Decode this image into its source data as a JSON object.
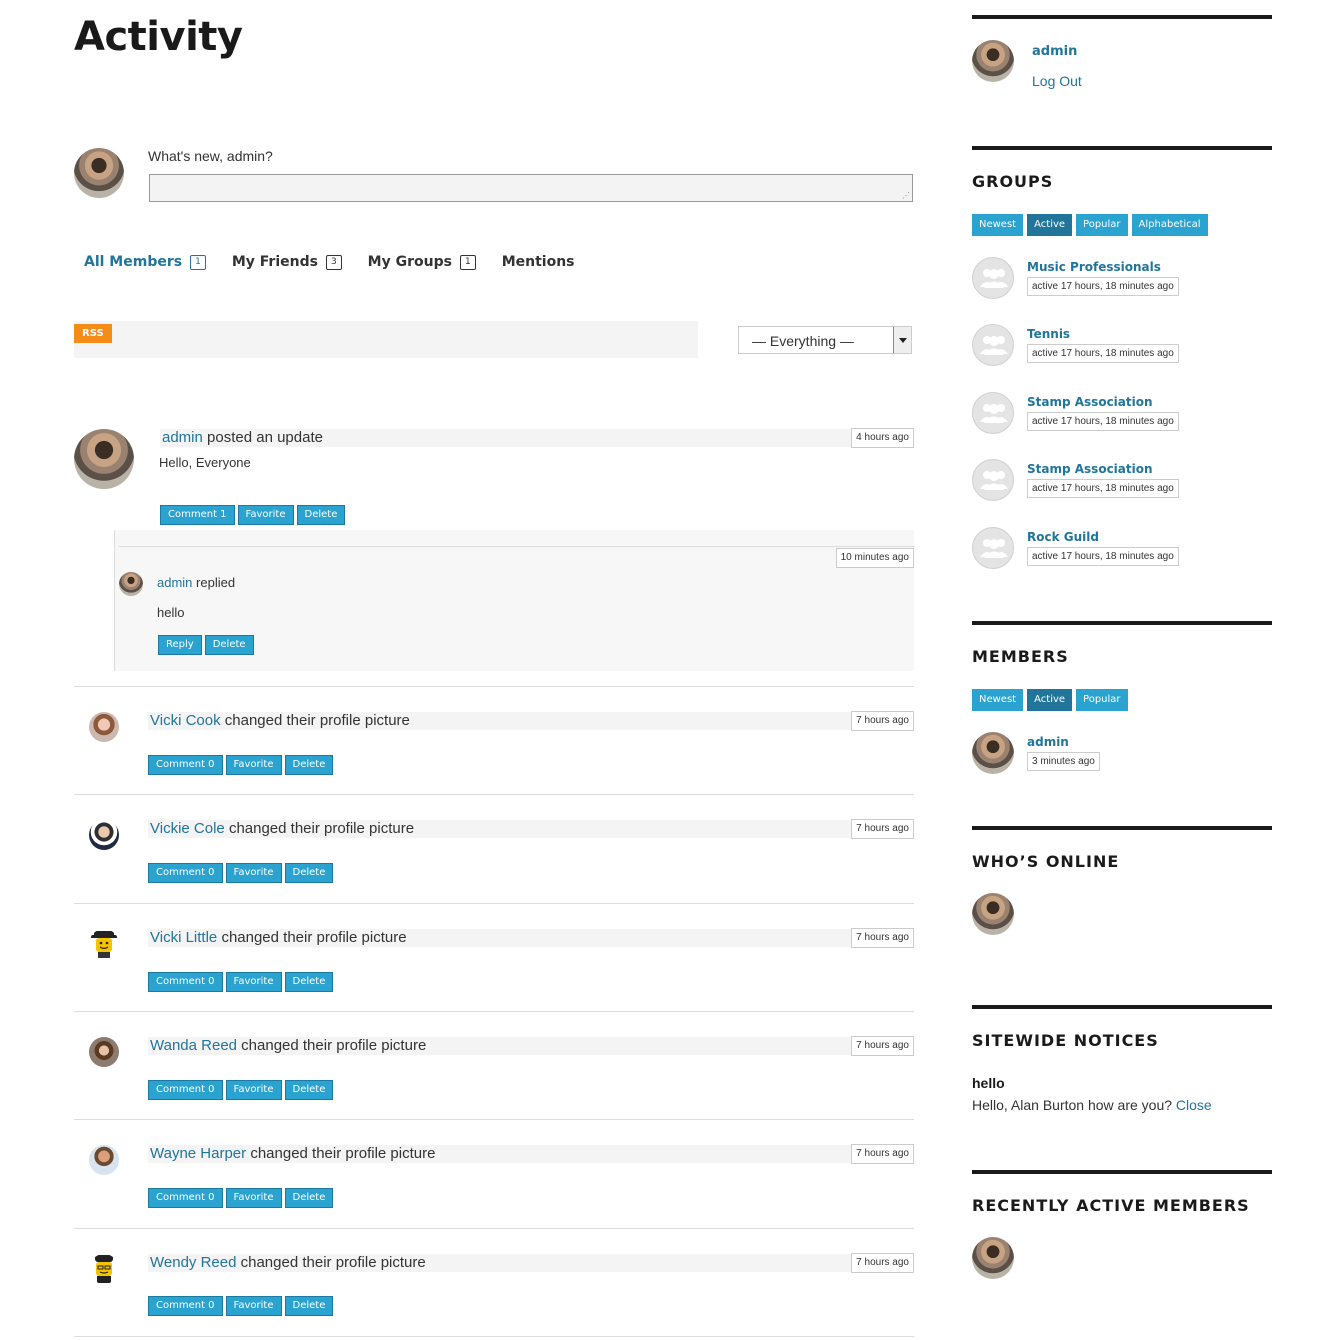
{
  "page": {
    "title": "Activity"
  },
  "post_form": {
    "greeting": "What's new, admin?",
    "placeholder": ""
  },
  "tabs": [
    {
      "label": "All Members",
      "count": "1"
    },
    {
      "label": "My Friends",
      "count": "3"
    },
    {
      "label": "My Groups",
      "count": "1"
    },
    {
      "label": "Mentions",
      "count": ""
    }
  ],
  "filter": {
    "rss_label": "RSS",
    "selected": "— Everything —"
  },
  "main_post": {
    "user": "admin",
    "action": "posted an update",
    "time": "4 hours ago",
    "content": "Hello, Everyone",
    "buttons": [
      "Comment 1",
      "Favorite",
      "Delete"
    ],
    "comment": {
      "time": "10 minutes ago",
      "user": "admin",
      "action": "replied",
      "content": "hello",
      "buttons": [
        "Reply",
        "Delete"
      ]
    }
  },
  "activities": [
    {
      "user": "Vicki Cook",
      "action": "changed their profile picture",
      "time": "7 hours ago",
      "buttons": [
        "Comment 0",
        "Favorite",
        "Delete"
      ]
    },
    {
      "user": "Vickie Cole",
      "action": "changed their profile picture",
      "time": "7 hours ago",
      "buttons": [
        "Comment 0",
        "Favorite",
        "Delete"
      ]
    },
    {
      "user": "Vicki Little",
      "action": "changed their profile picture",
      "time": "7 hours ago",
      "buttons": [
        "Comment 0",
        "Favorite",
        "Delete"
      ]
    },
    {
      "user": "Wanda Reed",
      "action": "changed their profile picture",
      "time": "7 hours ago",
      "buttons": [
        "Comment 0",
        "Favorite",
        "Delete"
      ]
    },
    {
      "user": "Wayne Harper",
      "action": "changed their profile picture",
      "time": "7 hours ago",
      "buttons": [
        "Comment 0",
        "Favorite",
        "Delete"
      ]
    },
    {
      "user": "Wendy Reed",
      "action": "changed their profile picture",
      "time": "7 hours ago",
      "buttons": [
        "Comment 0",
        "Favorite",
        "Delete"
      ]
    }
  ],
  "sidebar": {
    "account": {
      "username": "admin",
      "logout": "Log Out"
    },
    "groups": {
      "title": "GROUPS",
      "filters": [
        "Newest",
        "Active",
        "Popular",
        "Alphabetical"
      ],
      "items": [
        {
          "name": "Music Professionals",
          "active": "active 17 hours, 18 minutes ago"
        },
        {
          "name": "Tennis",
          "active": "active 17 hours, 18 minutes ago"
        },
        {
          "name": "Stamp Association",
          "active": "active 17 hours, 18 minutes ago"
        },
        {
          "name": "Stamp Association",
          "active": "active 17 hours, 18 minutes ago"
        },
        {
          "name": "Rock Guild",
          "active": "active 17 hours, 18 minutes ago"
        }
      ]
    },
    "members": {
      "title": "MEMBERS",
      "filters": [
        "Newest",
        "Active",
        "Popular"
      ],
      "items": [
        {
          "name": "admin",
          "active": "3 minutes ago"
        }
      ]
    },
    "whos_online": {
      "title": "WHO’S ONLINE"
    },
    "notices": {
      "title": "SITEWIDE NOTICES",
      "notice_title": "hello",
      "notice_text": "Hello, Alan Burton how are you?",
      "close": "Close"
    },
    "recent": {
      "title": "RECENTLY ACTIVE MEMBERS"
    }
  },
  "colors": {
    "accent": "#21759b",
    "button": "#2aa3d1",
    "rss": "#f58c18"
  }
}
